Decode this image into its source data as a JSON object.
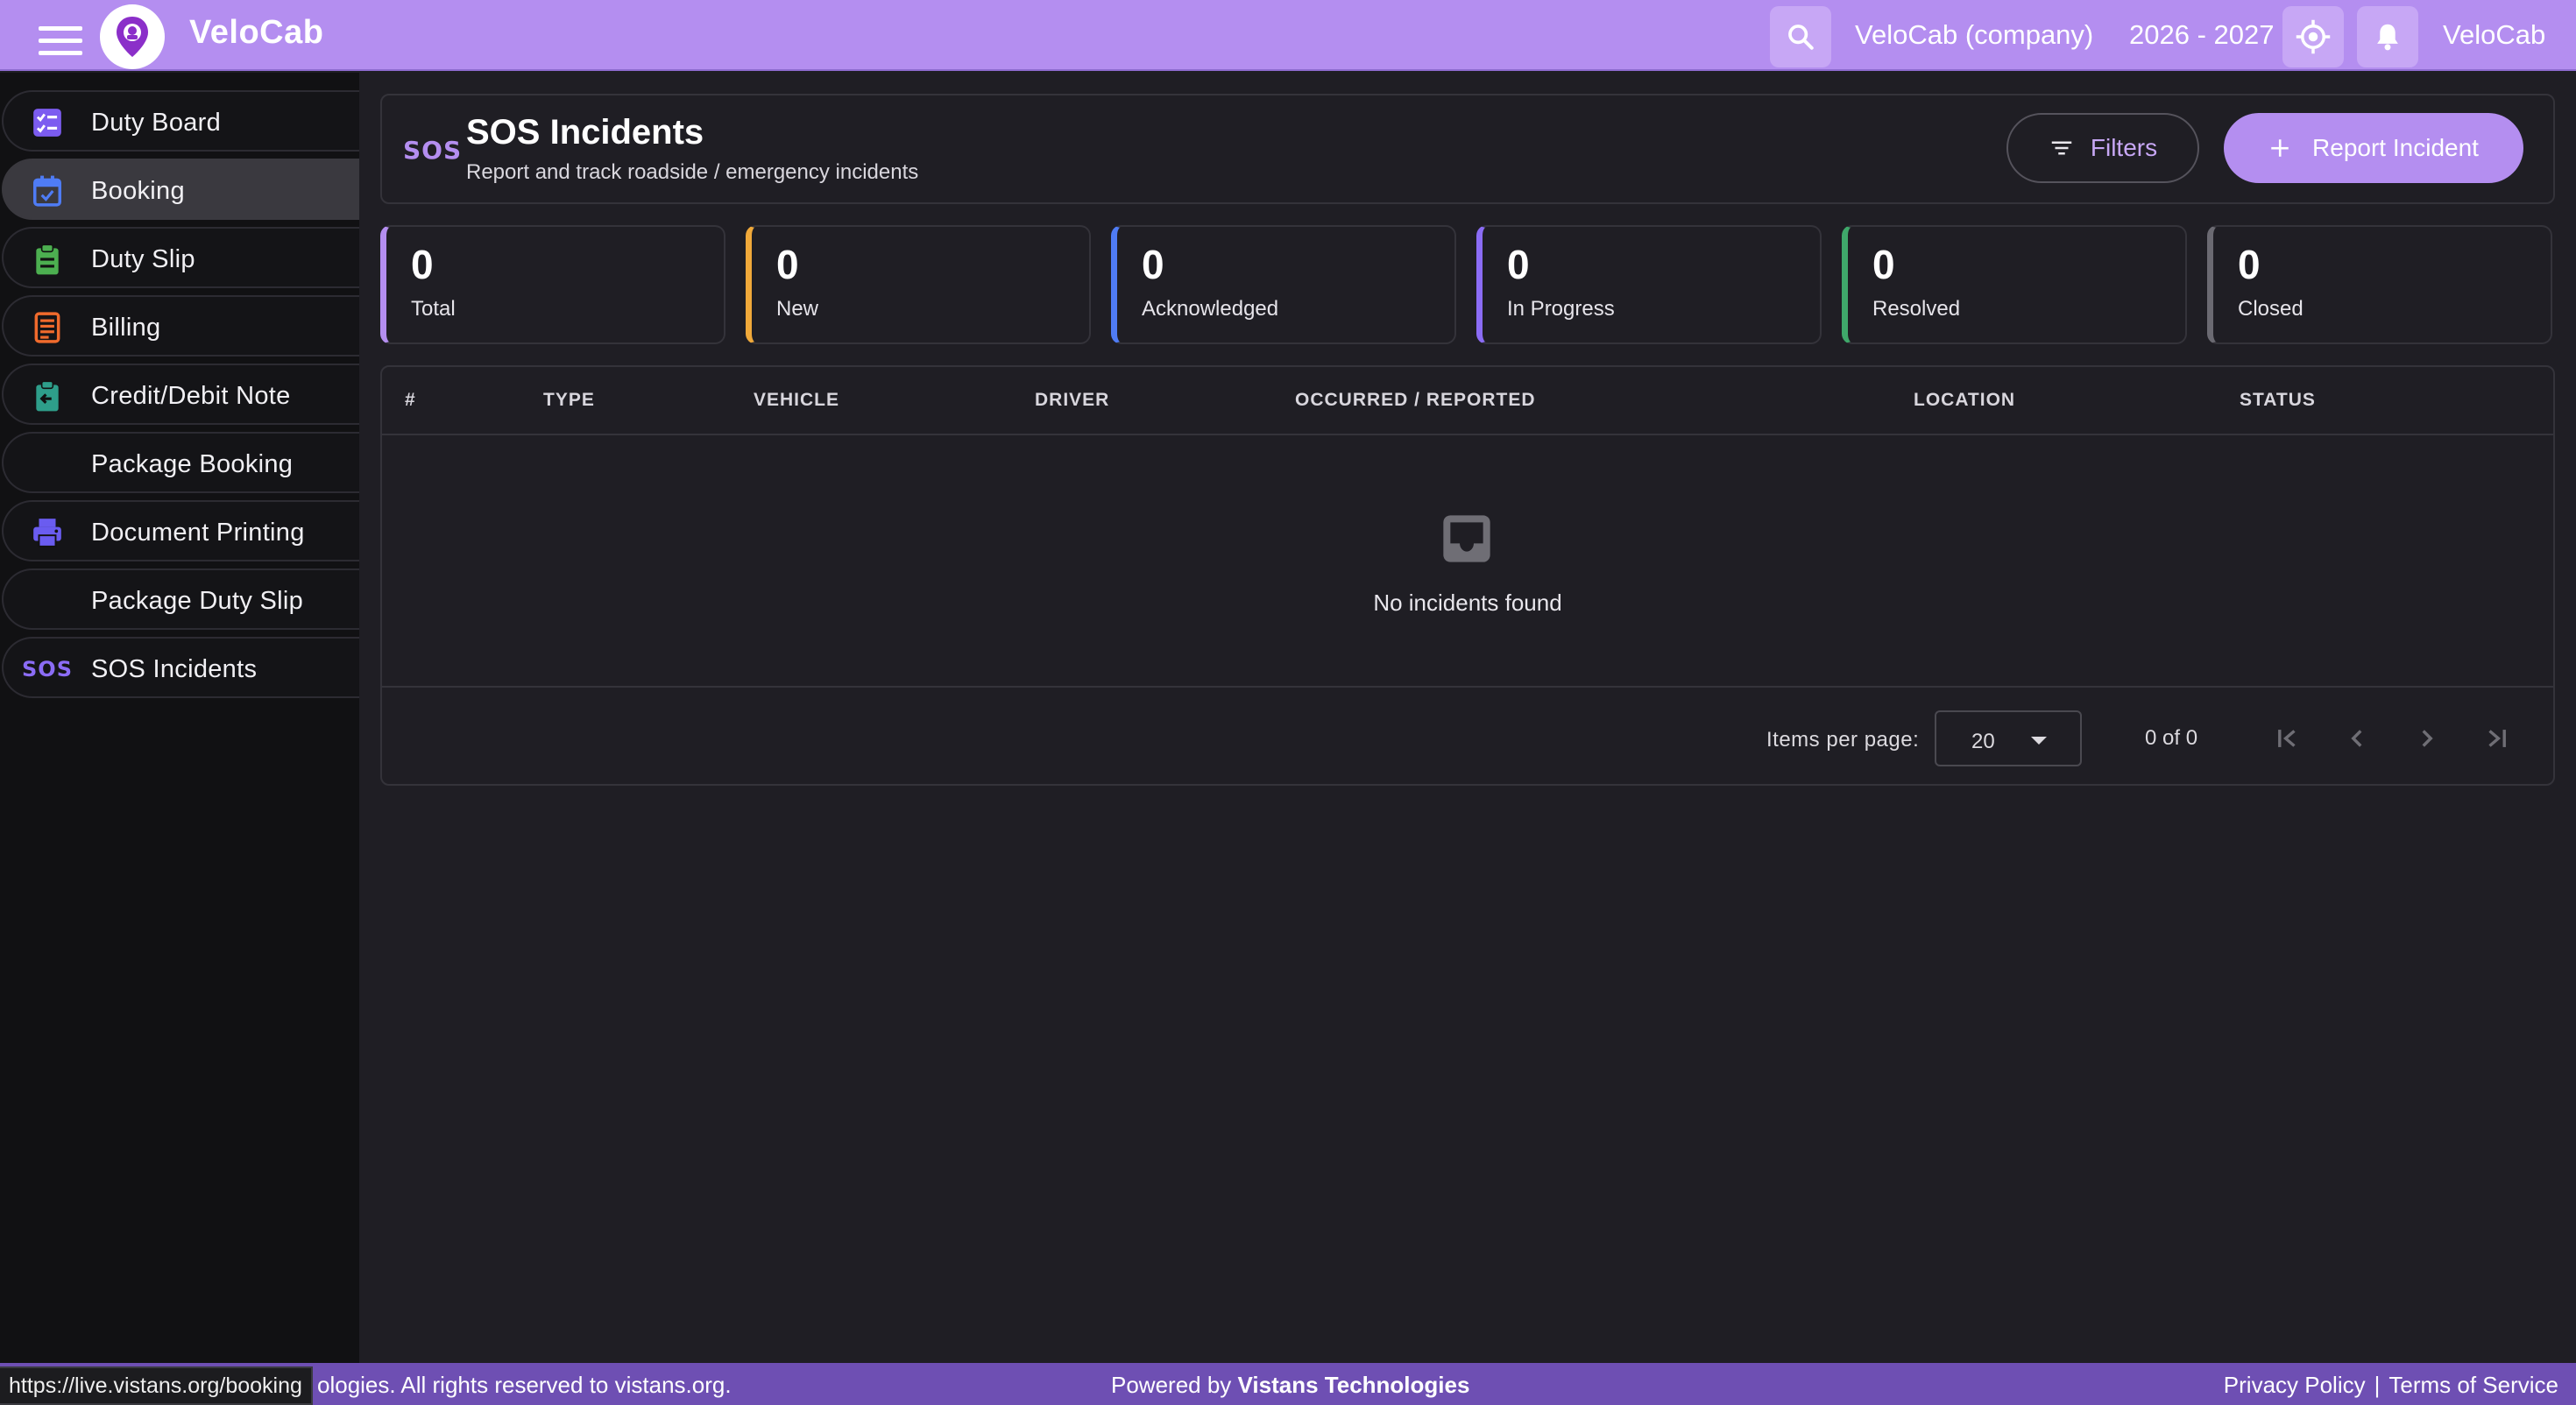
{
  "topbar": {
    "brand": "VeloCab",
    "company": "VeloCab (company)",
    "fiscal_year": "2026 - 2027",
    "user": "VeloCab"
  },
  "sidebar": {
    "items": [
      {
        "label": "Duty Board",
        "icon": "checklist-icon",
        "color": "#7c5cf0"
      },
      {
        "label": "Booking",
        "icon": "calendar-check-icon",
        "color": "#4f7cf5",
        "active": true
      },
      {
        "label": "Duty Slip",
        "icon": "clipboard-icon",
        "color": "#4caf50"
      },
      {
        "label": "Billing",
        "icon": "receipt-icon",
        "color": "#f06a2c"
      },
      {
        "label": "Credit/Debit Note",
        "icon": "clipboard-return-icon",
        "color": "#2e9e8a"
      },
      {
        "label": "Package Booking",
        "icon": "",
        "color": ""
      },
      {
        "label": "Document Printing",
        "icon": "printer-icon",
        "color": "#6a5cf0"
      },
      {
        "label": "Package Duty Slip",
        "icon": "",
        "color": ""
      },
      {
        "label": "SOS Incidents",
        "icon": "sos-icon",
        "icon_text": "SOS",
        "color": "#8b6cf5"
      }
    ]
  },
  "header": {
    "icon_text": "SOS",
    "title": "SOS Incidents",
    "subtitle": "Report and track roadside / emergency incidents",
    "filters_label": "Filters",
    "report_label": "Report Incident"
  },
  "stats": [
    {
      "value": "0",
      "label": "Total",
      "color": "#b48ef0"
    },
    {
      "value": "0",
      "label": "New",
      "color": "#f0a93a"
    },
    {
      "value": "0",
      "label": "Acknowledged",
      "color": "#4f7cf5"
    },
    {
      "value": "0",
      "label": "In Progress",
      "color": "#8b6cf5"
    },
    {
      "value": "0",
      "label": "Resolved",
      "color": "#3fa86a"
    },
    {
      "value": "0",
      "label": "Closed",
      "color": "#6b6a72"
    }
  ],
  "table": {
    "columns": [
      "#",
      "TYPE",
      "VEHICLE",
      "DRIVER",
      "OCCURRED / REPORTED",
      "LOCATION",
      "STATUS"
    ],
    "empty_text": "No incidents found"
  },
  "pagination": {
    "items_per_page_label": "Items per page:",
    "items_per_page": "20",
    "range": "0 of 0"
  },
  "footer": {
    "left": "ologies. All rights reserved to vistans.org.",
    "powered_prefix": "Powered by",
    "powered_by": "Vistans Technologies",
    "privacy": "Privacy Policy",
    "separator": "|",
    "terms": "Terms of Service"
  },
  "status_url": "https://live.vistans.org/booking"
}
